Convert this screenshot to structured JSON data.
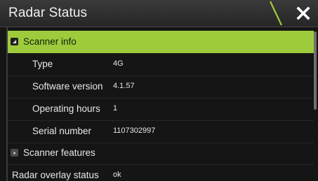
{
  "dialog": {
    "title": "Radar Status"
  },
  "icons": {
    "close": "close-icon",
    "collapse": "collapse-triangle-icon",
    "expand": "expand-triangle-icon"
  },
  "colors": {
    "selection": "#9ecb3c",
    "accent_slash": "#9ecb3c"
  },
  "sections": {
    "scanner_info": {
      "label": "Scanner info",
      "expanded": true,
      "items": [
        {
          "label": "Type",
          "value": "4G"
        },
        {
          "label": "Software version",
          "value": "4.1.57"
        },
        {
          "label": "Operating hours",
          "value": "1"
        },
        {
          "label": "Serial number",
          "value": "1107302997"
        }
      ]
    },
    "scanner_features": {
      "label": "Scanner features",
      "expanded": false
    },
    "radar_overlay": {
      "label": "Radar overlay status",
      "value": "ok"
    }
  }
}
